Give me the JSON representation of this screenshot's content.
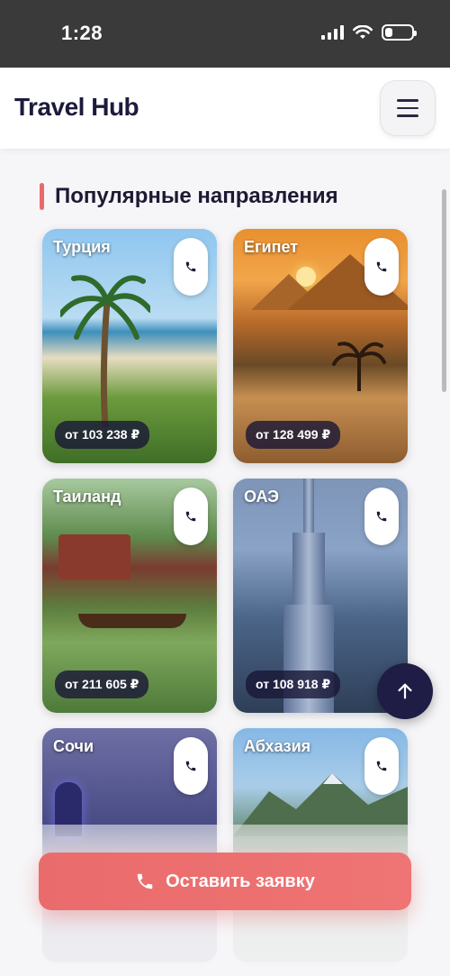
{
  "status_bar": {
    "time": "1:28"
  },
  "header": {
    "logo": "Travel Hub"
  },
  "section": {
    "title": "Популярные направления"
  },
  "destinations": [
    {
      "name": "Турция",
      "price": "от 103 238 ₽"
    },
    {
      "name": "Египет",
      "price": "от 128 499 ₽"
    },
    {
      "name": "Таиланд",
      "price": "от 211 605 ₽"
    },
    {
      "name": "ОАЭ",
      "price": "от 108 918 ₽"
    },
    {
      "name": "Сочи",
      "price": ""
    },
    {
      "name": "Абхазия",
      "price": ""
    }
  ],
  "cta": {
    "label": "Оставить заявку"
  },
  "colors": {
    "accent": "#e96a6a",
    "primary_dark": "#1f1d45",
    "cta": "#ee7070"
  },
  "icons": [
    "hamburger-menu-icon",
    "phone-icon",
    "arrow-up-icon"
  ]
}
